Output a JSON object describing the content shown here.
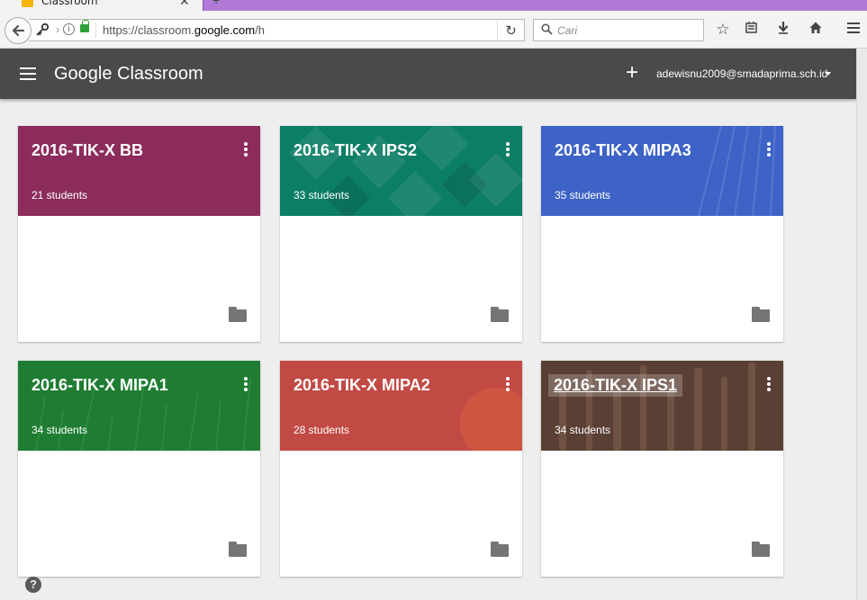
{
  "browser": {
    "tab_title": "Classroom",
    "tab_close": "✕",
    "new_tab": "+",
    "url_prefix": "https://classroom.",
    "url_domain": "google.com",
    "url_suffix": "/h",
    "search_placeholder": "Cari"
  },
  "appbar": {
    "title": "Google Classroom",
    "add_label": "+",
    "account": "adewisnu2009@smadaprima.sch.id"
  },
  "classes": [
    {
      "title": "2016-TIK-X BB",
      "students": "21 students",
      "color": "#8c2c5c"
    },
    {
      "title": "2016-TIK-X IPS2",
      "students": "33 students",
      "color": "#0d7e66"
    },
    {
      "title": "2016-TIK-X MIPA3",
      "students": "35 students",
      "color": "#3e63c7"
    },
    {
      "title": "2016-TIK-X MIPA1",
      "students": "34 students",
      "color": "#1f7d33"
    },
    {
      "title": "2016-TIK-X MIPA2",
      "students": "28 students",
      "color": "#c24a44"
    },
    {
      "title": "2016-TIK-X IPS1",
      "students": "34 students",
      "color": "#5a3f34"
    }
  ],
  "help_label": "?"
}
